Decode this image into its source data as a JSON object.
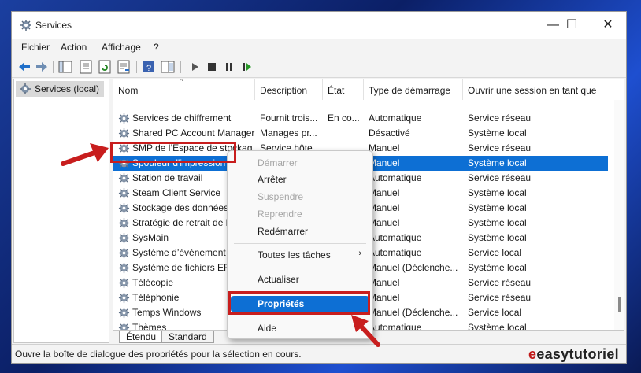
{
  "window": {
    "title": "Services",
    "icon": "services-gear-icon"
  },
  "titlebar_buttons": {
    "minimize": "—",
    "maximize": "☐",
    "close": "✕"
  },
  "menu": [
    "Fichier",
    "Action",
    "Affichage",
    "?"
  ],
  "toolbar_icons": [
    "back-arrow-icon",
    "forward-arrow-icon",
    "console-tree-icon",
    "properties-icon",
    "refresh-icon",
    "export-list-icon",
    "help-icon",
    "details-pane-icon",
    "play-icon",
    "stop-icon",
    "pause-icon",
    "restart-icon"
  ],
  "tree": {
    "selected": "Services (local)"
  },
  "columns": [
    "Nom",
    "Description",
    "État",
    "Type de démarrage",
    "Ouvrir une session en tant que"
  ],
  "rows": [
    {
      "name": "Services de chiffrement",
      "description": "Fournit trois...",
      "state": "En co...",
      "startup": "Automatique",
      "logon": "Service réseau"
    },
    {
      "name": "Shared PC Account Manager",
      "description": "Manages pr...",
      "state": "",
      "startup": "Désactivé",
      "logon": "Système local"
    },
    {
      "name": "SMP de l’Espace de stockag...",
      "description": "Service hôte...",
      "state": "",
      "startup": "Manuel",
      "logon": "Service réseau"
    },
    {
      "name": "Spouleur d'impression",
      "description": "",
      "state": "",
      "startup": "Manuel",
      "logon": "Système local"
    },
    {
      "name": "Station de travail",
      "description": "",
      "state": "",
      "startup": "Automatique",
      "logon": "Service réseau"
    },
    {
      "name": "Steam Client Service",
      "description": "",
      "state": "",
      "startup": "Manuel",
      "logon": "Système local"
    },
    {
      "name": "Stockage des données u",
      "description": "",
      "state": "",
      "startup": "Manuel",
      "logon": "Système local"
    },
    {
      "name": "Stratégie de retrait de la",
      "description": "",
      "state": "",
      "startup": "Manuel",
      "logon": "Système local"
    },
    {
      "name": "SysMain",
      "description": "",
      "state": "",
      "startup": "Automatique",
      "logon": "Système local"
    },
    {
      "name": "Système d’événement C",
      "description": "",
      "state": "",
      "startup": "Automatique",
      "logon": "Service local"
    },
    {
      "name": "Système de fichiers EFS",
      "description": "",
      "state": "",
      "startup": "Manuel (Déclenche...",
      "logon": "Système local"
    },
    {
      "name": "Télécopie",
      "description": "",
      "state": "",
      "startup": "Manuel",
      "logon": "Service réseau"
    },
    {
      "name": "Téléphonie",
      "description": "",
      "state": "",
      "startup": "Manuel",
      "logon": "Service réseau"
    },
    {
      "name": "Temps Windows",
      "description": "",
      "state": "",
      "startup": "Manuel (Déclenche...",
      "logon": "Service local"
    },
    {
      "name": "Thèmes",
      "description": "",
      "state": "",
      "startup": "Automatique",
      "logon": "Système local"
    }
  ],
  "tabs": [
    "Étendu",
    "Standard"
  ],
  "context_menu": {
    "items": [
      {
        "label": "Démarrer",
        "disabled": true
      },
      {
        "label": "Arrêter",
        "disabled": false
      },
      {
        "label": "Suspendre",
        "disabled": true
      },
      {
        "label": "Reprendre",
        "disabled": true
      },
      {
        "label": "Redémarrer",
        "disabled": false
      },
      {
        "label": "Toutes les tâches",
        "disabled": false,
        "submenu": "›"
      },
      {
        "label": "Actualiser",
        "disabled": false
      },
      {
        "label": "Propriétés",
        "disabled": false,
        "highlighted": true
      },
      {
        "label": "Aide",
        "disabled": false
      }
    ]
  },
  "status": "Ouvre la boîte de dialogue des propriétés pour la sélection en cours.",
  "watermark": {
    "e": "e",
    "text": "easytutoriel"
  },
  "colors": {
    "selection": "#0d6fd4",
    "annotation": "#c81e1e",
    "desktop": "#1b3fa0"
  }
}
